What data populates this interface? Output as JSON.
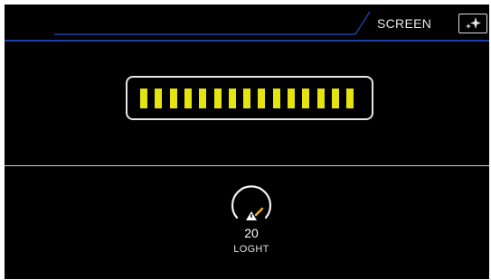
{
  "header": {
    "screen_label": "SCREEN",
    "sparkle_icon": "sparkle-icon",
    "accent_line_color": "#1a3fa6"
  },
  "level_meter": {
    "segments_lit": 15,
    "segments_total": 15,
    "segment_color": "#e6e40e"
  },
  "knob": {
    "value": "20",
    "label": "LOGHT",
    "indicator_color": "#f0b21a",
    "icon": "warning-triangle-icon"
  }
}
